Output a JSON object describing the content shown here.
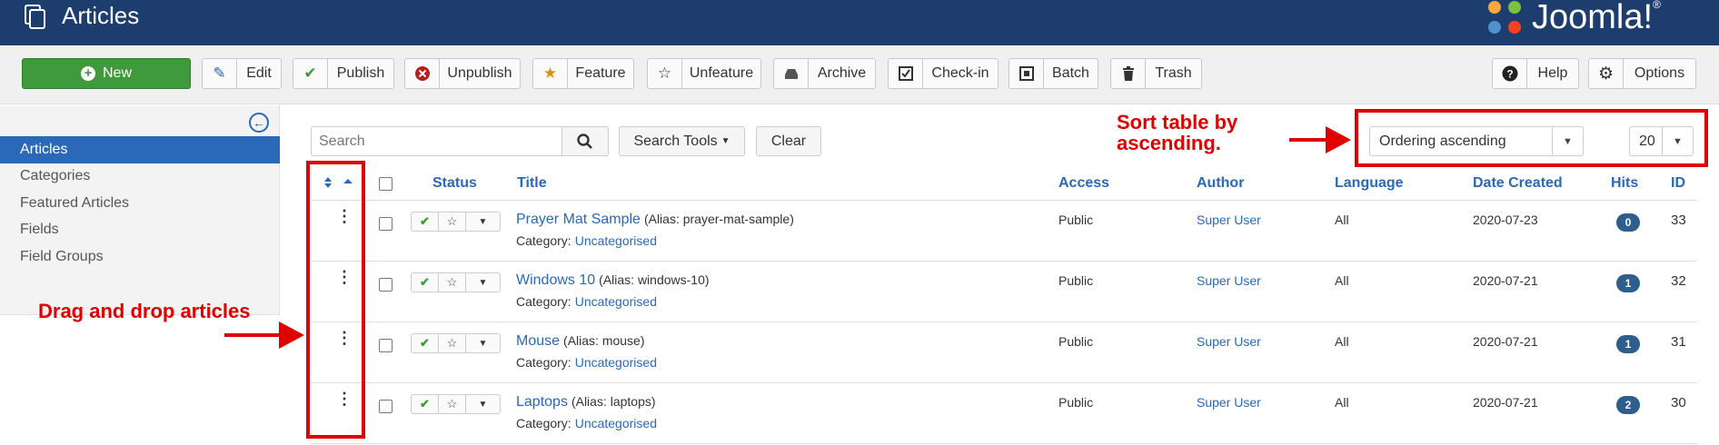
{
  "header": {
    "title": "Articles",
    "logo_text": "Joomla!",
    "logo_mark": "®"
  },
  "toolbar": {
    "new_label": "New",
    "edit_label": "Edit",
    "publish_label": "Publish",
    "unpublish_label": "Unpublish",
    "feature_label": "Feature",
    "unfeature_label": "Unfeature",
    "archive_label": "Archive",
    "checkin_label": "Check-in",
    "batch_label": "Batch",
    "trash_label": "Trash",
    "help_label": "Help",
    "options_label": "Options"
  },
  "sidebar": {
    "items": [
      {
        "label": "Articles",
        "active": true
      },
      {
        "label": "Categories",
        "active": false
      },
      {
        "label": "Featured Articles",
        "active": false
      },
      {
        "label": "Fields",
        "active": false
      },
      {
        "label": "Field Groups",
        "active": false
      }
    ]
  },
  "filters": {
    "search_placeholder": "Search",
    "search_tools_label": "Search Tools",
    "clear_label": "Clear",
    "ordering_value": "Ordering ascending",
    "limit_value": "20"
  },
  "table": {
    "headers": {
      "status": "Status",
      "title": "Title",
      "access": "Access",
      "author": "Author",
      "language": "Language",
      "date_created": "Date Created",
      "hits": "Hits",
      "id": "ID"
    },
    "rows": [
      {
        "title": "Prayer Mat Sample",
        "alias": "(Alias: prayer-mat-sample)",
        "category_label": "Category:",
        "category": "Uncategorised",
        "access": "Public",
        "author": "Super User",
        "language": "All",
        "date": "2020-07-23",
        "hits": "0",
        "id": "33"
      },
      {
        "title": "Windows 10",
        "alias": "(Alias: windows-10)",
        "category_label": "Category:",
        "category": "Uncategorised",
        "access": "Public",
        "author": "Super User",
        "language": "All",
        "date": "2020-07-21",
        "hits": "1",
        "id": "32"
      },
      {
        "title": "Mouse",
        "alias": "(Alias: mouse)",
        "category_label": "Category:",
        "category": "Uncategorised",
        "access": "Public",
        "author": "Super User",
        "language": "All",
        "date": "2020-07-21",
        "hits": "1",
        "id": "31"
      },
      {
        "title": "Laptops",
        "alias": "(Alias: laptops)",
        "category_label": "Category:",
        "category": "Uncategorised",
        "access": "Public",
        "author": "Super User",
        "language": "All",
        "date": "2020-07-21",
        "hits": "2",
        "id": "30"
      }
    ]
  },
  "annotations": {
    "sort_note_line1": "Sort table by",
    "sort_note_line2": "ascending.",
    "drag_note": "Drag and drop articles"
  },
  "colors": {
    "header_bg": "#1c3d6e",
    "accent": "#2a69b8",
    "new_button": "#3e9a3b",
    "annotation": "#e00000"
  },
  "icons": [
    "articles-copy-icon",
    "plus-circle-icon",
    "edit-icon",
    "check-icon",
    "x-circle-icon",
    "star-filled-icon",
    "star-outline-icon",
    "archive-icon",
    "checkbox-icon",
    "batch-icon",
    "trash-icon",
    "question-icon",
    "gear-icon",
    "search-icon",
    "chevron-down-icon",
    "sort-icon",
    "drag-handle-icon"
  ]
}
